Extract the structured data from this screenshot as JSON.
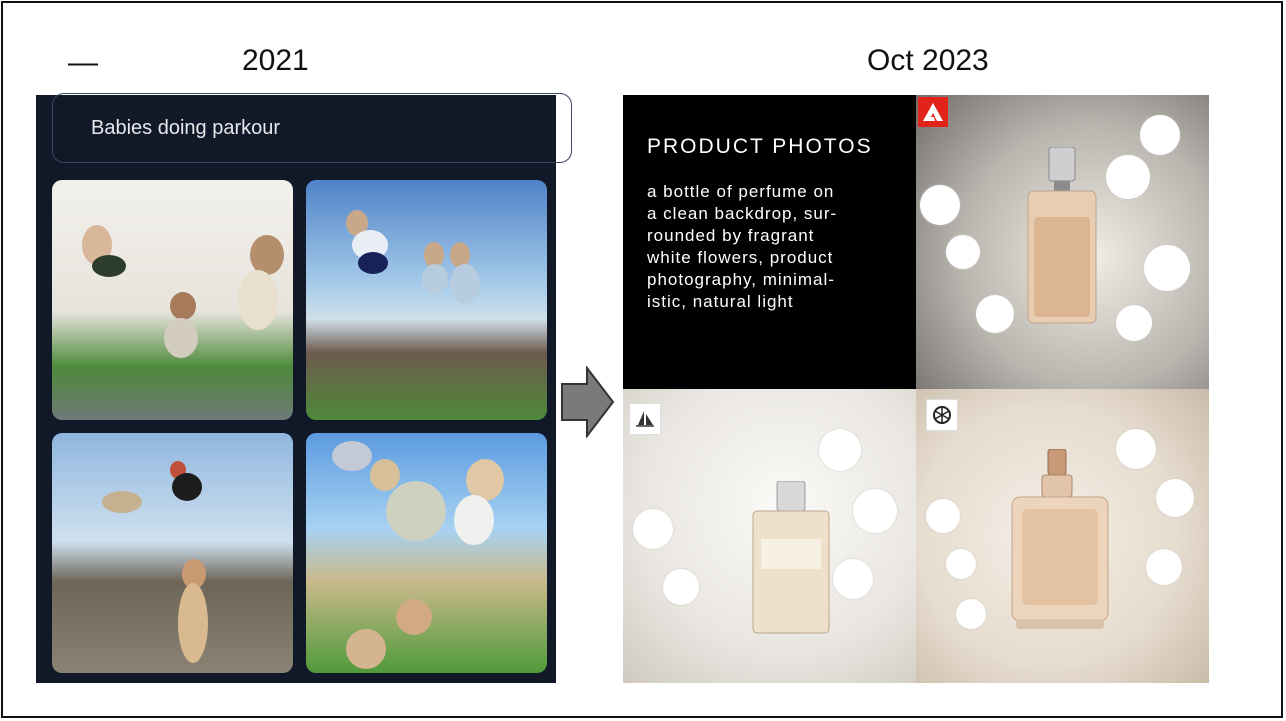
{
  "header": {
    "dash": "—",
    "left_label": "2021",
    "right_label": "Oct 2023"
  },
  "left_panel": {
    "prompt": "Babies doing parkour"
  },
  "right_panel": {
    "title": "PRODUCT PHOTOS",
    "body": "a bottle of perfume on\na clean backdrop, sur-\nrounded by fragrant\nwhite flowers, product\nphotography, minimal-\nistic, natural light"
  },
  "icons": {
    "arrow": "right-arrow-icon",
    "adobe": "adobe-logo-icon",
    "midjourney": "midjourney-logo-icon",
    "openai": "openai-logo-icon"
  },
  "colors": {
    "left_panel_bg": "#111827",
    "adobe_red": "#e2231a"
  }
}
